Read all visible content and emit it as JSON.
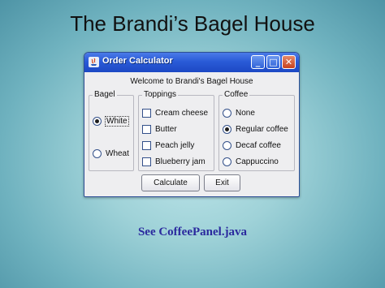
{
  "slide": {
    "title": "The Brandi’s Bagel House",
    "caption": "See CoffeePanel.java"
  },
  "window": {
    "title": "Order Calculator",
    "welcome": "Welcome to Brandi's Bagel House",
    "controls": {
      "minimize": "_",
      "maximize": "□",
      "close": "✕"
    }
  },
  "bagel": {
    "label": "Bagel",
    "options": [
      {
        "label": "White",
        "selected": true
      },
      {
        "label": "Wheat",
        "selected": false
      }
    ]
  },
  "toppings": {
    "label": "Toppings",
    "options": [
      {
        "label": "Cream cheese",
        "checked": false
      },
      {
        "label": "Butter",
        "checked": false
      },
      {
        "label": "Peach jelly",
        "checked": false
      },
      {
        "label": "Blueberry jam",
        "checked": false
      }
    ]
  },
  "coffee": {
    "label": "Coffee",
    "options": [
      {
        "label": "None",
        "selected": false
      },
      {
        "label": "Regular coffee",
        "selected": true
      },
      {
        "label": "Decaf coffee",
        "selected": false
      },
      {
        "label": "Cappuccino",
        "selected": false
      }
    ]
  },
  "buttons": {
    "calculate": "Calculate",
    "exit": "Exit"
  }
}
